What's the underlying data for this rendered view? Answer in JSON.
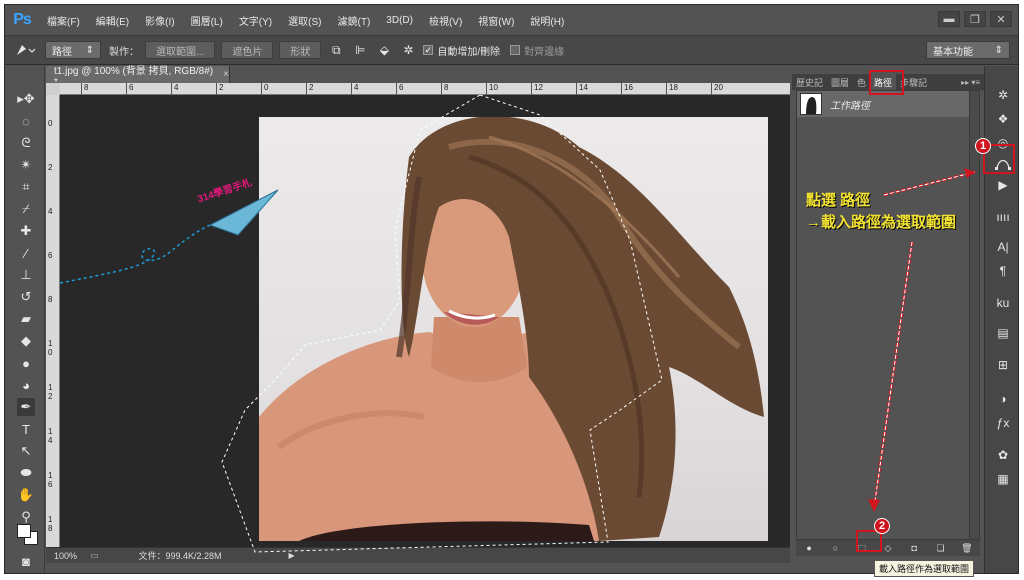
{
  "app": {
    "logo": "Ps",
    "menu": [
      "檔案(F)",
      "編輯(E)",
      "影像(I)",
      "圖層(L)",
      "文字(Y)",
      "選取(S)",
      "濾鏡(T)",
      "3D(D)",
      "檢視(V)",
      "視窗(W)",
      "說明(H)"
    ],
    "window_buttons": [
      "▬",
      "❐",
      "✕"
    ]
  },
  "options_bar": {
    "tool_icon": "pen-icon",
    "mode_select": "路徑",
    "make_label": "製作：",
    "selection_button": "選取範圍...",
    "mask_button": "遮色片",
    "shape_button": "形狀",
    "auto_add_delete": "自動增加/刪除",
    "auto_add_delete_checked": true,
    "align_edges": "對齊邊緣",
    "align_edges_checked": false,
    "workspace": "基本功能"
  },
  "document": {
    "tab_title": "t1.jpg @ 100% (背景 拷貝, RGB/8#) *",
    "tab_close": "×",
    "ruler_h": [
      "8",
      "6",
      "4",
      "2",
      "0",
      "2",
      "4",
      "6",
      "8",
      "10",
      "12",
      "14",
      "16",
      "18",
      "20"
    ],
    "ruler_v": [
      "0",
      "2",
      "4",
      "6",
      "8",
      "1\n0",
      "1\n2",
      "1\n4",
      "1\n6",
      "1\n8"
    ],
    "zoom": "100%",
    "doc_size": "文件：999.4K/2.28M",
    "status_arrow": "▶"
  },
  "panels": {
    "tabs": [
      "歷史記",
      "圖層",
      "色",
      "路徑",
      "步驟記"
    ],
    "active_tab": "路徑",
    "path_name": "工作路徑",
    "menu_icon": "▸▸ ▾≡",
    "bottom_icons": [
      "fill-path-icon",
      "stroke-path-icon",
      "load-selection-icon",
      "make-work-path-icon",
      "add-mask-icon",
      "new-path-icon",
      "delete-path-icon"
    ]
  },
  "annotations": {
    "badge1": "1",
    "badge2": "2",
    "line1": "點選 路徑",
    "line2": "→載入路徑為選取範圍",
    "tooltip": "載入路徑作為選取範圍",
    "watermark": "314學習手札",
    "red": "#d0151f",
    "yellow": "#f2e232"
  }
}
